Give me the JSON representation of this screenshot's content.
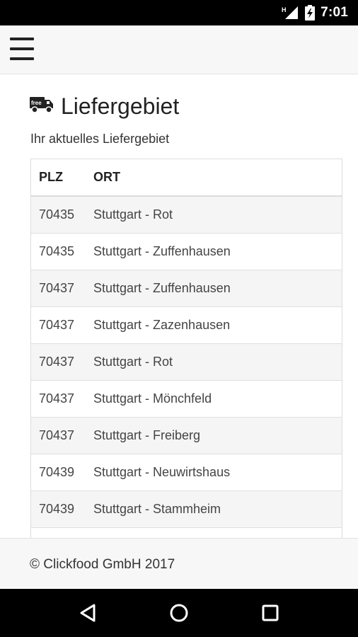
{
  "status_bar": {
    "time": "7:01",
    "signal_label": "H",
    "icons": [
      "signal-icon",
      "battery-icon"
    ]
  },
  "app_bar": {
    "menu_icon": "hamburger-menu-icon"
  },
  "page": {
    "title": "Liefergebiet",
    "title_icon": "delivery-truck-icon",
    "truck_label": "free",
    "subtitle": "Ihr aktuelles Liefergebiet"
  },
  "table": {
    "headers": {
      "plz": "PLZ",
      "ort": "ORT"
    },
    "rows": [
      {
        "plz": "70435",
        "ort": "Stuttgart - Rot"
      },
      {
        "plz": "70435",
        "ort": "Stuttgart - Zuffenhausen"
      },
      {
        "plz": "70437",
        "ort": "Stuttgart - Zuffenhausen"
      },
      {
        "plz": "70437",
        "ort": "Stuttgart - Zazenhausen"
      },
      {
        "plz": "70437",
        "ort": "Stuttgart - Rot"
      },
      {
        "plz": "70437",
        "ort": "Stuttgart - Mönchfeld"
      },
      {
        "plz": "70437",
        "ort": "Stuttgart - Freiberg"
      },
      {
        "plz": "70439",
        "ort": "Stuttgart - Neuwirtshaus"
      },
      {
        "plz": "70439",
        "ort": "Stuttgart - Stammheim"
      },
      {
        "plz": "",
        "ort": ""
      }
    ]
  },
  "footer": {
    "copyright": "© Clickfood GmbH 2017"
  },
  "nav_bar": {
    "icons": [
      "back-icon",
      "home-icon",
      "recents-icon"
    ]
  },
  "colors": {
    "status_bar_bg": "#000000",
    "app_bar_bg": "#f7f7f7",
    "row_stripe": "#f5f5f5",
    "text": "#222222"
  }
}
